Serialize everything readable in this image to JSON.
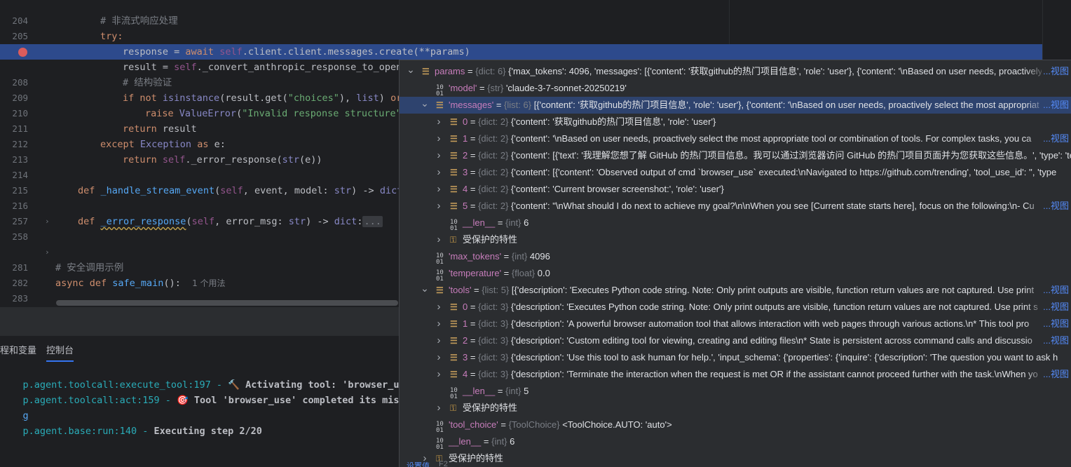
{
  "editor": {
    "lines": [
      {
        "num": "204",
        "code": ""
      },
      {
        "num": "205",
        "code": "# 非流式响应处理"
      },
      {
        "num": "206",
        "code": "try:"
      },
      {
        "num": "",
        "code": "response = await self.client.client.messages.create(**params)"
      },
      {
        "num": "208",
        "code": "result = self._convert_anthropic_response_to_open"
      },
      {
        "num": "209",
        "code": "# 结构验证"
      },
      {
        "num": "210",
        "code": "if not isinstance(result.get(\"choices\"), list) or"
      },
      {
        "num": "211",
        "code": "raise ValueError(\"Invalid response structure\""
      },
      {
        "num": "212",
        "code": "return result"
      },
      {
        "num": "213",
        "code": "except Exception as e:"
      },
      {
        "num": "214",
        "code": "return self._error_response(str(e))"
      },
      {
        "num": "215",
        "code": ""
      },
      {
        "num": "216",
        "code": "def _handle_stream_event(self, event, model: str) -> dict"
      },
      {
        "num": "257",
        "code": ""
      },
      {
        "num": "258",
        "code": "def _error_response(self, error_msg: str) -> dict:..."
      },
      {
        "num": "281",
        "code": ""
      },
      {
        "num": "282",
        "code": "# 安全调用示例"
      },
      {
        "num": "283",
        "code": "async def safe_main():"
      },
      {
        "num": "284",
        "code": ""
      }
    ],
    "usage_hint": "1 个用法",
    "fold_placeholder": "..."
  },
  "panel": {
    "tabs": [
      "程和变量",
      "控制台"
    ],
    "console": [
      {
        "module": "p.agent.toolcall:execute_tool:197",
        "sep": " - ",
        "icon": "🔨",
        "message": " Activating tool: 'browser_use'..."
      },
      {
        "module": "p.agent.toolcall:act:159",
        "sep": " - ",
        "icon": "🎯",
        "message": " Tool 'browser_use' completed its mission!"
      },
      {
        "module": "",
        "sep": "",
        "icon": "",
        "message": "g"
      },
      {
        "module": "p.agent.base:run:140",
        "sep": " - ",
        "icon": "",
        "message": "Executing step 2/20"
      }
    ]
  },
  "debugger": {
    "view_label": "视图",
    "rows": [
      {
        "indent": 0,
        "expand": "open",
        "icon": "dict",
        "name": "params",
        "type": "{dict: 6}",
        "value": "{'max_tokens': 4096, 'messages': [{'content': '获取github的热门项目信息', 'role': 'user'}, {'content': '\\nBased on user needs, proactively",
        "more": "...",
        "view": true
      },
      {
        "indent": 1,
        "expand": "none",
        "icon": "prim",
        "name": "'model'",
        "type": "{str}",
        "value": "'claude-3-7-sonnet-20250219'"
      },
      {
        "indent": 1,
        "expand": "open",
        "icon": "list",
        "name": "'messages'",
        "type": "{list: 6}",
        "value": "[{'content': '获取github的热门项目信息', 'role': 'user'}, {'content': '\\nBased on user needs, proactively select the most appropriat",
        "more": "...",
        "view": true,
        "selected": true
      },
      {
        "indent": 2,
        "expand": "closed",
        "icon": "dict",
        "name": "0",
        "type": "{dict: 2}",
        "value": "{'content': '获取github的热门项目信息', 'role': 'user'}"
      },
      {
        "indent": 2,
        "expand": "closed",
        "icon": "dict",
        "name": "1",
        "type": "{dict: 2}",
        "value": "{'content': '\\nBased on user needs, proactively select the most appropriate tool or combination of tools. For complex tasks, you ca",
        "more": "...",
        "view": true
      },
      {
        "indent": 2,
        "expand": "closed",
        "icon": "dict",
        "name": "2",
        "type": "{dict: 2}",
        "value": "{'content': [{'text': '我理解您想了解 GitHub 的热门项目信息。我可以通过浏览器访问 GitHub 的热门项目页面并为您获取这些信息。', 'type': 'text'}],"
      },
      {
        "indent": 2,
        "expand": "closed",
        "icon": "dict",
        "name": "3",
        "type": "{dict: 2}",
        "value": "{'content': [{'content': 'Observed output of cmd `browser_use` executed:\\nNavigated to https://github.com/trending', 'tool_use_id': '', 'type"
      },
      {
        "indent": 2,
        "expand": "closed",
        "icon": "dict",
        "name": "4",
        "type": "{dict: 2}",
        "value": "{'content': 'Current browser screenshot:', 'role': 'user'}"
      },
      {
        "indent": 2,
        "expand": "closed",
        "icon": "dict",
        "name": "5",
        "type": "{dict: 2}",
        "value": "{'content': \"\\nWhat should I do next to achieve my goal?\\n\\nWhen you see [Current state starts here], focus on the following:\\n- Cu",
        "more": "...",
        "view": true
      },
      {
        "indent": 2,
        "expand": "none",
        "icon": "prim",
        "name": "__len__",
        "type": "{int}",
        "value": "6"
      },
      {
        "indent": 2,
        "expand": "closed",
        "icon": "key",
        "name": "受保护的特性",
        "type": "",
        "value": ""
      },
      {
        "indent": 1,
        "expand": "none",
        "icon": "prim",
        "name": "'max_tokens'",
        "type": "{int}",
        "value": "4096"
      },
      {
        "indent": 1,
        "expand": "none",
        "icon": "prim",
        "name": "'temperature'",
        "type": "{float}",
        "value": "0.0"
      },
      {
        "indent": 1,
        "expand": "open",
        "icon": "list",
        "name": "'tools'",
        "type": "{list: 5}",
        "value": "[{'description': 'Executes Python code string. Note: Only print outputs are visible, function return values are not captured. Use print",
        "more": "...",
        "view": true
      },
      {
        "indent": 2,
        "expand": "closed",
        "icon": "dict",
        "name": "0",
        "type": "{dict: 3}",
        "value": "{'description': 'Executes Python code string. Note: Only print outputs are visible, function return values are not captured. Use print s",
        "more": "...",
        "view": true
      },
      {
        "indent": 2,
        "expand": "closed",
        "icon": "dict",
        "name": "1",
        "type": "{dict: 3}",
        "value": "{'description': 'A powerful browser automation tool that allows interaction with web pages through various actions.\\n* This tool pro",
        "more": "...",
        "view": true
      },
      {
        "indent": 2,
        "expand": "closed",
        "icon": "dict",
        "name": "2",
        "type": "{dict: 3}",
        "value": "{'description': 'Custom editing tool for viewing, creating and editing files\\n* State is persistent across command calls and discussio",
        "more": "...",
        "view": true
      },
      {
        "indent": 2,
        "expand": "closed",
        "icon": "dict",
        "name": "3",
        "type": "{dict: 3}",
        "value": "{'description': 'Use this tool to ask human for help.', 'input_schema': {'properties': {'inquire': {'description': 'The question you want to ask h"
      },
      {
        "indent": 2,
        "expand": "closed",
        "icon": "dict",
        "name": "4",
        "type": "{dict: 3}",
        "value": "{'description': 'Terminate the interaction when the request is met OR if the assistant cannot proceed further with the task.\\nWhen yo",
        "more": "...",
        "view": true
      },
      {
        "indent": 2,
        "expand": "none",
        "icon": "prim",
        "name": "__len__",
        "type": "{int}",
        "value": "5"
      },
      {
        "indent": 2,
        "expand": "closed",
        "icon": "key",
        "name": "受保护的特性",
        "type": "",
        "value": ""
      },
      {
        "indent": 1,
        "expand": "none",
        "icon": "prim",
        "name": "'tool_choice'",
        "type": "{ToolChoice}",
        "value": "<ToolChoice.AUTO: 'auto'>"
      },
      {
        "indent": 1,
        "expand": "none",
        "icon": "prim",
        "name": "__len__",
        "type": "{int}",
        "value": "6"
      },
      {
        "indent": 1,
        "expand": "closed",
        "icon": "key",
        "name": "受保护的特性",
        "type": "",
        "value": ""
      }
    ],
    "footer_label": "设置值",
    "footer_value": "F2"
  },
  "colors": {
    "background": "#1e1f22",
    "highlight_line": "#2d4a8c",
    "selected_row": "#2e436e",
    "breakpoint": "#db5c5c",
    "link": "#548af7"
  }
}
